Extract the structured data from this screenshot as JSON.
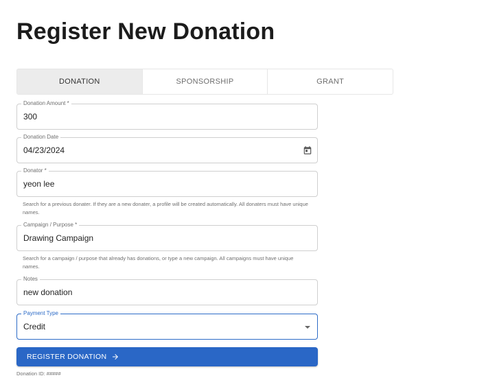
{
  "page": {
    "title": "Register New Donation"
  },
  "tabs": [
    {
      "label": "DONATION",
      "active": true
    },
    {
      "label": "SPONSORSHIP",
      "active": false
    },
    {
      "label": "GRANT",
      "active": false
    }
  ],
  "form": {
    "amount": {
      "label": "Donation Amount *",
      "value": "300"
    },
    "date": {
      "label": "Donation Date",
      "value": "04/23/2024"
    },
    "donator": {
      "label": "Donator *",
      "value": "yeon lee",
      "help": "Search for a previous donater. If they are a new donater, a profile will be created automatically. All donaters must have unique names."
    },
    "campaign": {
      "label": "Campaign / Purpose *",
      "value": "Drawing Campaign",
      "help": "Search for a campaign / purpose that already has donations, or type a new campaign. All campaigns must have unique names."
    },
    "notes": {
      "label": "Notes",
      "value": "new donation"
    },
    "payment": {
      "label": "Payment Type",
      "value": "Credit"
    }
  },
  "actions": {
    "register_label": "REGISTER DONATION"
  },
  "footer": {
    "donation_id": "Donation ID: #####"
  },
  "icons": {
    "date": "calendar-icon",
    "payment": "caret-down-icon",
    "register": "arrow-right-icon"
  },
  "colors": {
    "primary": "#2a67c6",
    "active_tab_bg": "#ececec"
  }
}
